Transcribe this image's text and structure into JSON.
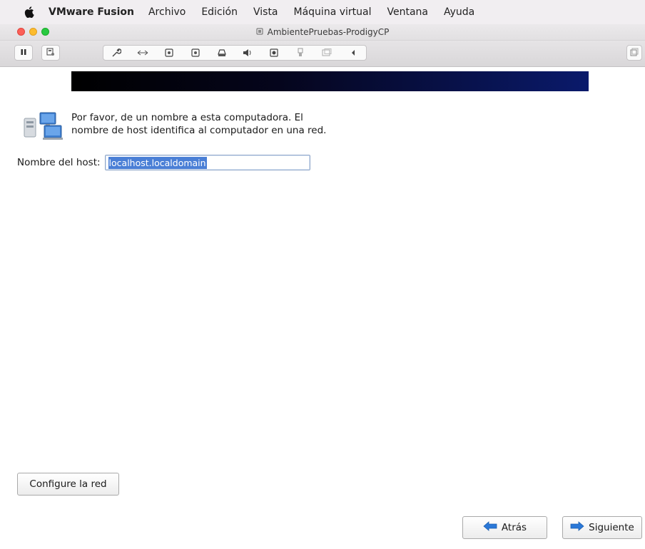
{
  "menubar": {
    "app_name": "VMware Fusion",
    "items": [
      "Archivo",
      "Edición",
      "Vista",
      "Máquina virtual",
      "Ventana",
      "Ayuda"
    ]
  },
  "window": {
    "title": "AmbientePruebas-ProdigyCP"
  },
  "installer": {
    "intro_line1": "Por favor, de un nombre a esta computadora. El",
    "intro_line2": "nombre de host identifica al computador en una red.",
    "host_label": "Nombre del host:",
    "host_value": "localhost.localdomain",
    "configure_network_label": "Configure la red",
    "back_label": "Atrás",
    "next_label": "Siguiente"
  },
  "colors": {
    "banner_start": "#000000",
    "banner_end": "#0a1a6b",
    "selection": "#4a7fd6",
    "arrow_blue": "#2a78d8"
  }
}
